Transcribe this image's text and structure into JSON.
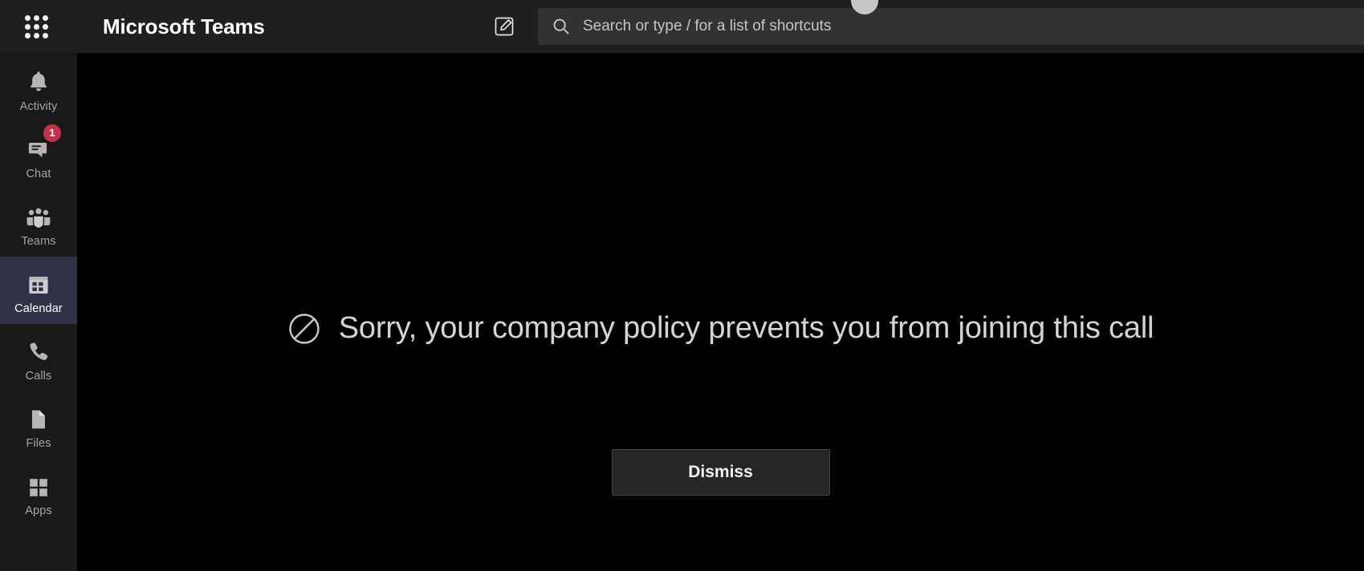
{
  "header": {
    "waffle_icon": "app-launcher-grid-icon",
    "title": "Microsoft Teams",
    "compose_icon": "compose-new-chat-icon",
    "search": {
      "icon": "search-icon",
      "placeholder": "Search or type / for a list of shortcuts",
      "value": ""
    }
  },
  "rail": {
    "items": [
      {
        "id": "activity",
        "label": "Activity",
        "icon": "bell-icon",
        "selected": false,
        "badge": ""
      },
      {
        "id": "chat",
        "label": "Chat",
        "icon": "chat-bubble-icon",
        "selected": false,
        "badge": "1"
      },
      {
        "id": "teams",
        "label": "Teams",
        "icon": "teams-people-icon",
        "selected": false,
        "badge": ""
      },
      {
        "id": "calendar",
        "label": "Calendar",
        "icon": "calendar-icon",
        "selected": true,
        "badge": ""
      },
      {
        "id": "calls",
        "label": "Calls",
        "icon": "phone-icon",
        "selected": false,
        "badge": ""
      },
      {
        "id": "files",
        "label": "Files",
        "icon": "file-document-icon",
        "selected": false,
        "badge": ""
      },
      {
        "id": "apps",
        "label": "Apps",
        "icon": "apps-grid-icon",
        "selected": false,
        "badge": ""
      }
    ]
  },
  "main": {
    "status_icon": "blocked-circle-slash-icon",
    "message": "Sorry, your company policy prevents you from joining this call",
    "dismiss_label": "Dismiss"
  },
  "colors": {
    "app_background": "#000000",
    "header_background": "#201f1f",
    "rail_background": "#1a1919",
    "rail_selected_background": "#32314a",
    "search_background": "#333232",
    "badge_background": "#c4314b",
    "button_background": "#272626",
    "button_border": "#484747",
    "primary_text": "#ffffff",
    "muted_text": "#a6a4a2",
    "message_text": "#d6d4d2"
  }
}
